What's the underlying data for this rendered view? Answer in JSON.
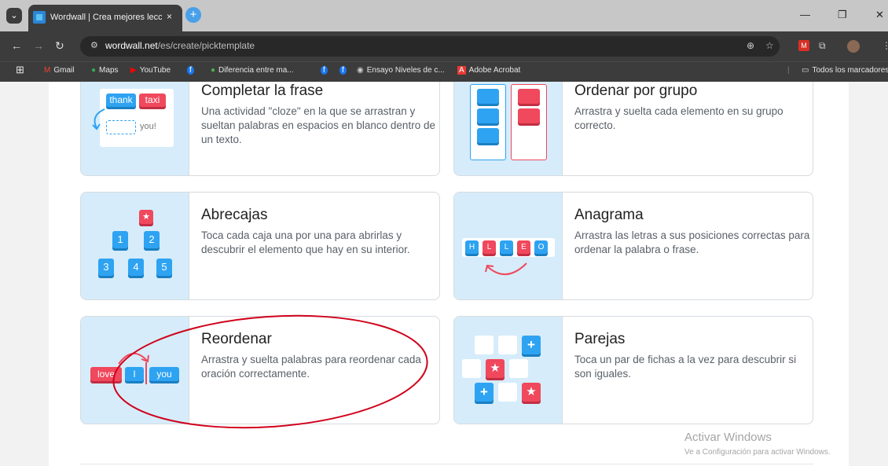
{
  "browser": {
    "tab_title": "Wordwall | Crea mejores leccion",
    "tab_close": "×",
    "new_tab": "+",
    "tab_menu": "⌄",
    "url_host": "wordwall.net",
    "url_path": "/es/create/picktemplate",
    "bookmarks": [
      {
        "label": "Gmail",
        "icon": "gmail-icon",
        "color": "#ea4335"
      },
      {
        "label": "Maps",
        "icon": "maps-icon",
        "color": "#34a853"
      },
      {
        "label": "YouTube",
        "icon": "youtube-icon",
        "color": "#ff0000"
      },
      {
        "label": "Diferencia entre ma...",
        "icon": "globe-icon",
        "color": "#4caf50"
      },
      {
        "label": "Ensayo Niveles de c...",
        "icon": "globe-icon",
        "color": "#cccccc"
      },
      {
        "label": "Adobe Acrobat",
        "icon": "acrobat-icon",
        "color": "#e53935"
      }
    ],
    "all_bookmarks": "Todos los marcadores"
  },
  "templates": [
    {
      "title": "Completar la frase",
      "desc": "Una actividad \"cloze\" en la que se arrastran y sueltan palabras en espacios en blanco dentro de un texto.",
      "tiles": {
        "thank": "thank",
        "taxi": "taxi",
        "you": "you!"
      }
    },
    {
      "title": "Ordenar por grupo",
      "desc": "Arrastra y suelta cada elemento en su grupo correcto."
    },
    {
      "title": "Abrecajas",
      "desc": "Toca cada caja una por una para abrirlas y descubrir el elemento que hay en su interior.",
      "numbers": [
        "1",
        "2",
        "3",
        "4",
        "5"
      ]
    },
    {
      "title": "Anagrama",
      "desc": "Arrastra las letras a sus posiciones correctas para ordenar la palabra o frase.",
      "letters": [
        "H",
        "L",
        "L",
        "E",
        "O"
      ]
    },
    {
      "title": "Reordenar",
      "desc": "Arrastra y suelta palabras para reordenar cada oración correctamente.",
      "words": [
        "love",
        "I",
        "you"
      ]
    },
    {
      "title": "Parejas",
      "desc": "Toca un par de fichas a la vez para descubrir si son iguales."
    }
  ],
  "watermark": {
    "title": "Activar Windows",
    "subtitle": "Ve a Configuración para activar Windows."
  },
  "colors": {
    "accent_blue": "#2ea3f2",
    "accent_red": "#f0485c",
    "thumb_bg": "#d6ecfa",
    "annotation": "#d0021b"
  }
}
